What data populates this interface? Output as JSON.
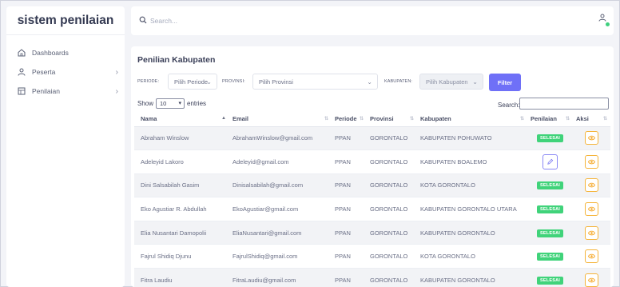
{
  "app": {
    "brand": "sistem penilaian"
  },
  "sidebar": {
    "items": [
      {
        "label": "Dashboards",
        "icon": "home-icon",
        "chevron": ""
      },
      {
        "label": "Peserta",
        "icon": "user-icon",
        "chevron": "›"
      },
      {
        "label": "Penilaian",
        "icon": "clipboard-icon",
        "chevron": "›"
      }
    ]
  },
  "topbar": {
    "search_placeholder": "Search..."
  },
  "card": {
    "title": "Penilian Kabupaten",
    "filters": {
      "periode_label": "PERIODE:",
      "periode_value": "Pilih Periode",
      "provinsi_label": "PROVINSI:",
      "provinsi_value": "Pilih Provinsi",
      "kabupaten_label": "KABUPATEN:",
      "kabupaten_value": "Pilih Kabupaten",
      "filter_button": "Filter"
    },
    "show_prefix": "Show",
    "show_value": "10",
    "show_suffix": "entries",
    "search_label": "Search:"
  },
  "table": {
    "columns": [
      "Nama",
      "Email",
      "Periode",
      "Provinsi",
      "Kabupaten",
      "Penilaian",
      "Aksi"
    ],
    "rows": [
      {
        "nama": "Abraham Winslow",
        "email": "AbrahamWinslow@gmail.com",
        "periode": "PPAN",
        "provinsi": "GORONTALO",
        "kabupaten": "KABUPATEN POHUWATO",
        "status": "SELESAI"
      },
      {
        "nama": "Adeleyid Lakoro",
        "email": "Adeleyid@gmail.com",
        "periode": "PPAN",
        "provinsi": "GORONTALO",
        "kabupaten": "KABUPATEN BOALEMO",
        "status": ""
      },
      {
        "nama": "Dini Salsabilah Gasim",
        "email": "Dinisalsabilah@gmail.com",
        "periode": "PPAN",
        "provinsi": "GORONTALO",
        "kabupaten": "KOTA GORONTALO",
        "status": "SELESAI"
      },
      {
        "nama": "Eko Agustiar R. Abdullah",
        "email": "EkoAgustiar@gmail.com",
        "periode": "PPAN",
        "provinsi": "GORONTALO",
        "kabupaten": "KABUPATEN GORONTALO UTARA",
        "status": "SELESAI"
      },
      {
        "nama": "Elia Nusantari Damopolii",
        "email": "EliaNusantari@gmail.com",
        "periode": "PPAN",
        "provinsi": "GORONTALO",
        "kabupaten": "KABUPATEN GORONTALO",
        "status": "SELESAI"
      },
      {
        "nama": "Fajrul Shidiq Djunu",
        "email": "FajrulShidiq@gmail.com",
        "periode": "PPAN",
        "provinsi": "GORONTALO",
        "kabupaten": "KOTA GORONTALO",
        "status": "SELESAI"
      },
      {
        "nama": "Fitra Laudiu",
        "email": "FitraLaudiu@gmail.com",
        "periode": "PPAN",
        "provinsi": "GORONTALO",
        "kabupaten": "KABUPATEN GORONTALO",
        "status": "SELESAI"
      }
    ]
  },
  "colors": {
    "accent": "#6f70f7",
    "success": "#40d37a",
    "warning": "#f5b43a"
  }
}
